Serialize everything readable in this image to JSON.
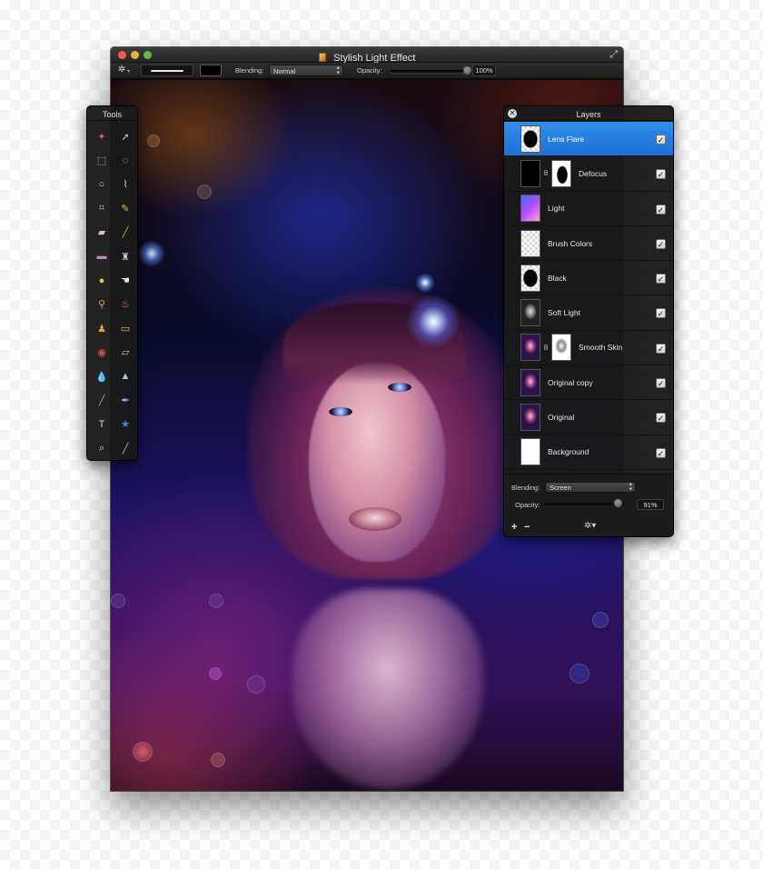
{
  "window": {
    "title": "Stylish Light Effect"
  },
  "toolbar": {
    "blending_label": "Blending:",
    "blending_value": "Normal",
    "opacity_label": "Opacity:",
    "opacity_value": "100%",
    "opacity_level": 1.0
  },
  "tools_panel": {
    "title": "Tools",
    "tools": [
      {
        "name": "magic-wand-icon",
        "glyph": "✦",
        "color": "#e0508a"
      },
      {
        "name": "move-arrow-icon",
        "glyph": "➚",
        "color": "#c8c8c8"
      },
      {
        "name": "rect-select-icon",
        "glyph": "⬚",
        "color": "#cfcfcf"
      },
      {
        "name": "ellipse-select-icon",
        "glyph": "◌",
        "color": "#cfcfcf"
      },
      {
        "name": "lasso-icon",
        "glyph": "○",
        "color": "#cfcfcf"
      },
      {
        "name": "polygon-lasso-icon",
        "glyph": "⌇",
        "color": "#cfcfcf"
      },
      {
        "name": "crop-icon",
        "glyph": "⌗",
        "color": "#d9b36a"
      },
      {
        "name": "pencil-icon",
        "glyph": "✎",
        "color": "#f0c040"
      },
      {
        "name": "eraser-icon",
        "glyph": "▰",
        "color": "#f2b6c2"
      },
      {
        "name": "brush-icon",
        "glyph": "╱",
        "color": "#7bd23a"
      },
      {
        "name": "gradient-icon",
        "glyph": "▬",
        "color": "#d07ae0"
      },
      {
        "name": "bucket-icon",
        "glyph": "♜",
        "color": "#b8c8e8"
      },
      {
        "name": "sponge-icon",
        "glyph": "●",
        "color": "#f3c230"
      },
      {
        "name": "smudge-icon",
        "glyph": "☚",
        "color": "#e8e8e8"
      },
      {
        "name": "burn-icon",
        "glyph": "⚲",
        "color": "#e8a040"
      },
      {
        "name": "dodge-icon",
        "glyph": "♨",
        "color": "#f08030"
      },
      {
        "name": "stamp-icon",
        "glyph": "♟",
        "color": "#e89a40"
      },
      {
        "name": "bandage-icon",
        "glyph": "▭",
        "color": "#f0b080"
      },
      {
        "name": "red-eye-icon",
        "glyph": "◉",
        "color": "#e05050"
      },
      {
        "name": "eraser-pink-icon",
        "glyph": "▱",
        "color": "#f0b8c8"
      },
      {
        "name": "blur-drop-icon",
        "glyph": "💧",
        "color": "#6aa8f0"
      },
      {
        "name": "sharpen-icon",
        "glyph": "▲",
        "color": "#a8c8f0"
      },
      {
        "name": "pen-icon",
        "glyph": "╱",
        "color": "#6ab0f0"
      },
      {
        "name": "pen-add-icon",
        "glyph": "✒",
        "color": "#8ab8f0"
      },
      {
        "name": "text-icon",
        "glyph": "T",
        "color": "#d8d8d8"
      },
      {
        "name": "shape-star-icon",
        "glyph": "★",
        "color": "#3a8ef0"
      },
      {
        "name": "zoom-icon",
        "glyph": "⌕",
        "color": "#d8d8d8"
      },
      {
        "name": "eyedropper-icon",
        "glyph": "╱",
        "color": "#e8a050"
      }
    ]
  },
  "layers_panel": {
    "title": "Layers",
    "layers": [
      {
        "name": "Lens Flare",
        "visible": true,
        "selected": true,
        "thumb": "black-on-checker",
        "mask": null
      },
      {
        "name": "Defocus",
        "visible": true,
        "selected": false,
        "thumb": "dark",
        "mask": "mask-black"
      },
      {
        "name": "Light",
        "visible": true,
        "selected": false,
        "thumb": "light",
        "mask": null
      },
      {
        "name": "Brush Colors",
        "visible": true,
        "selected": false,
        "thumb": "checker",
        "mask": null
      },
      {
        "name": "Black",
        "visible": true,
        "selected": false,
        "thumb": "black-on-checker",
        "mask": null
      },
      {
        "name": "Soft Light",
        "visible": true,
        "selected": false,
        "thumb": "gray-portrait",
        "mask": null
      },
      {
        "name": "Smooth Skin",
        "visible": true,
        "selected": false,
        "thumb": "color-portrait",
        "mask": "mask-bw"
      },
      {
        "name": "Original copy",
        "visible": true,
        "selected": false,
        "thumb": "color-portrait",
        "mask": null
      },
      {
        "name": "Original",
        "visible": true,
        "selected": false,
        "thumb": "color-portrait",
        "mask": null
      },
      {
        "name": "Background",
        "visible": true,
        "selected": false,
        "thumb": "white",
        "mask": null
      }
    ],
    "blending_label": "Blending:",
    "blending_value": "Screen",
    "opacity_label": "Opacity:",
    "opacity_value": "91%",
    "opacity_level": 0.91,
    "add_label": "+",
    "remove_label": "−"
  }
}
